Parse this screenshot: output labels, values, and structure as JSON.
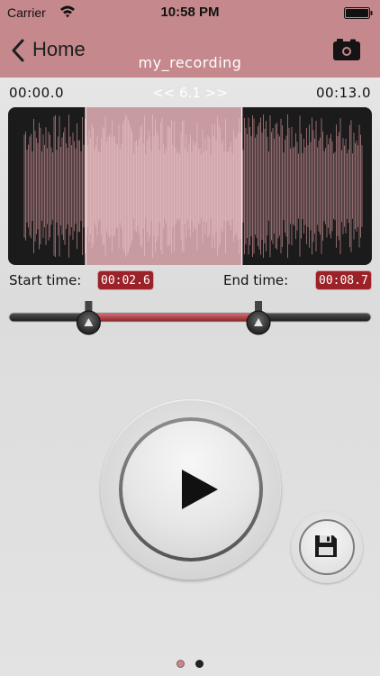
{
  "status_bar": {
    "carrier": "Carrier",
    "time": "10:58 PM"
  },
  "nav": {
    "back_label": "Home",
    "title": "my_recording"
  },
  "timeline": {
    "start": "00:00.0",
    "end": "00:13.0",
    "zoom": "<< 6.1 >>"
  },
  "trim": {
    "start_label": "Start time:",
    "start_value": "00:02.6",
    "end_label": "End time:",
    "end_value": "00:08.7",
    "duration_seconds": 13.0,
    "start_seconds": 2.6,
    "end_seconds": 8.7
  },
  "colors": {
    "header": "#c4888d",
    "selection": "#c79ba0",
    "badge": "#9a2228",
    "slider_active": "#b8474d"
  },
  "icons": {
    "back": "chevron-left-icon",
    "camera": "camera-icon",
    "play": "play-icon",
    "save": "floppy-disk-icon"
  },
  "pager": {
    "pages": 2,
    "current": 1
  }
}
